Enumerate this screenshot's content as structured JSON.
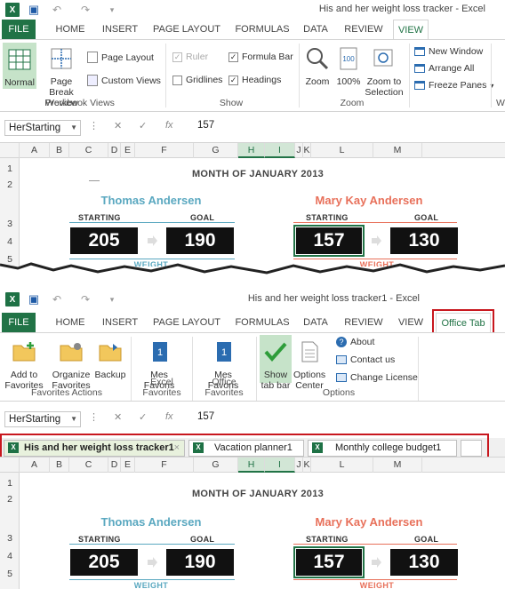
{
  "top": {
    "title": "His and her weight loss tracker - Excel",
    "tabs": [
      "FILE",
      "HOME",
      "INSERT",
      "PAGE LAYOUT",
      "FORMULAS",
      "DATA",
      "REVIEW",
      "VIEW"
    ],
    "active_tab": "VIEW",
    "ribbon": {
      "normal": "Normal",
      "page_break": "Page Break Preview",
      "page_layout": "Page Layout",
      "custom_views": "Custom Views",
      "group_workbook_views": "Workbook Views",
      "ruler": "Ruler",
      "formula_bar": "Formula Bar",
      "gridlines": "Gridlines",
      "headings": "Headings",
      "group_show": "Show",
      "zoom": "Zoom",
      "zoom100": "100%",
      "zoom_selection": "Zoom to Selection",
      "group_zoom": "Zoom",
      "new_window": "New Window",
      "arrange_all": "Arrange All",
      "freeze_panes": "Freeze Panes",
      "group_w": "W"
    },
    "name_box": "HerStarting",
    "formula_value": "157"
  },
  "bottom": {
    "title": "His and her weight loss tracker1 - Excel",
    "tabs": [
      "FILE",
      "HOME",
      "INSERT",
      "PAGE LAYOUT",
      "FORMULAS",
      "DATA",
      "REVIEW",
      "VIEW",
      "Office Tab"
    ],
    "active_tab": "Office Tab",
    "ribbon": {
      "add_to_favorites": "Add to Favorites",
      "organize_favorites": "Organize Favorites",
      "backup": "Backup",
      "group_favorites_actions": "Favorites Actions",
      "mes_favoris_1": "Mes Favoris",
      "group_excel_favorites": "Excel Favorites",
      "mes_favoris_2": "Mes Favoris",
      "group_office_favorites": "Office Favorites",
      "show_tab_bar": "Show tab bar",
      "options_center": "Options Center",
      "about": "About",
      "contact_us": "Contact us",
      "change_license": "Change License",
      "group_options": "Options"
    },
    "name_box": "HerStarting",
    "formula_value": "157",
    "doc_tabs": [
      "His and her weight loss tracker1",
      "Vacation planner1",
      "Monthly college budget1"
    ]
  },
  "columns": [
    "A",
    "B",
    "C",
    "D",
    "E",
    "F",
    "G",
    "H",
    "I",
    "J",
    "K",
    "L",
    "M"
  ],
  "rows": [
    "1",
    "2",
    "3",
    "4",
    "5"
  ],
  "sheet": {
    "month": "MONTH OF JANUARY 2013",
    "him_name": "Thomas Andersen",
    "her_name": "Mary Kay Andersen",
    "starting_label": "STARTING",
    "goal_label": "GOAL",
    "weight_label": "WEIGHT",
    "him_starting": "205",
    "him_goal": "190",
    "her_starting": "157",
    "her_goal": "130"
  },
  "colors": {
    "excel_green": "#217346",
    "him": "#5aa8c0",
    "her": "#e8705a",
    "highlight": "#c8171e"
  }
}
